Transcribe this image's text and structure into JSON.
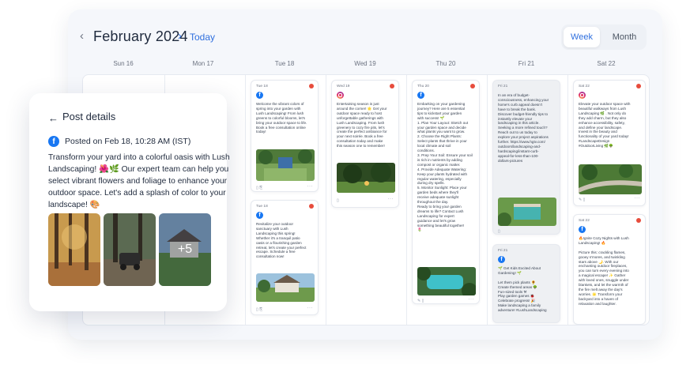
{
  "header": {
    "prev_icon": "‹",
    "month_title": "February 2024",
    "next_icon": "›",
    "today_label": "Today",
    "views": [
      "Week",
      "Month"
    ],
    "active_view": "Week"
  },
  "days": [
    "Sun 16",
    "Mon 17",
    "Tue 18",
    "Wed 19",
    "Thu 20",
    "Fri 21",
    "Sat 22"
  ],
  "cards": [
    {
      "date": "Tue 18",
      "network": "facebook-icon",
      "text": "Welcome the vibrant colors of\nspring into your garden with\nLush Landscaping! From lush\ngreens to colorful blooms, let's\nbring your outdoor space to life.\nBook a free consultation online\ntoday!"
    },
    {
      "date": "Tue 18",
      "network": "facebook-icon",
      "text": "Revitalize your outdoor\nsanctuary with Lush\nLandscaping this spring!\nWhether it's a tranquil patio\noasis or a flourishing garden\nretreat, let's create your perfect\nescape. Schedule a free\nconsultation now!"
    },
    {
      "date": "Wed 19",
      "network": "instagram-icon",
      "text": "Entertaining season is just\naround the corner! 🌟 Get your\noutdoor space ready to host\nunforgettable gatherings with\nLush Landscaping. From lush\ngreenery to cozy fire pits, let's\ncreate the perfect ambiance for\nyour next soirée. Book a free\nconsultation today and make\nthis season one to remember!"
    },
    {
      "date": "Thu 20",
      "network": "facebook-icon",
      "text": "Embarking on your gardening\njourney? Here are 5 essential\ntips to kickstart your garden\nwith success! 🌱\n1. Plan Your Layout: Sketch out\nyour garden space and decide\nwhat plants you want to grow.\n2. Choose the Right Plants:\nSelect plants that thrive in your\nlocal climate and soil\nconditions.\n3. Prep Your Soil: Ensure your soil\nis rich in nutrients by adding\ncompost or organic matter.\n4. Provide Adequate Watering:\nKeep your plants hydrated with\nregular watering, especially\nduring dry spells.\n5. Monitor Sunlight: Place your\ngarden beds where they'll\nreceive adequate sunlight\nthroughout the day.\nReady to bring your garden\ndreams to life? Contact Lush\nLandscaping for expert\nguidance and let's grow\nsomething beautiful together!\n🌷"
    },
    {
      "date": "Fri 21",
      "network": "",
      "text": "In an era of budget-\nconsciousness, enhancing your\nhome's curb appeal doesn't\nhave to break the bank.\nDiscover budget-friendly tips to\ninstantly elevate your\nlandscaping in this article.\nSeeking a more refined touch?\nReach out to us today to\nexplore your project aspirations\nfurther. https://www.hgtv.com/\noutdoors/landscaping-and-\nhardscaping/instant-curb-\nappeal-for-less-than-100-\ndollars-pictures"
    },
    {
      "date": "Fri 21",
      "network": "facebook-icon",
      "text": "🌱 Get Kids Excited About\nGardening! 🌱\n\nLet them pick plants 🌻\nCreate themed areas 🌳\nFun-sized tools ⚒\nPlay garden games 🐞\nCelebrate progress! 🎉\nMake landscaping a family\nadventure! #LushLandscaping"
    },
    {
      "date": "Sat 22",
      "network": "instagram-icon",
      "text": "Elevate your outdoor space with\nbeautiful walkways from Lush\nLandscaping 🌿 . Not only do\nthey add charm, but they also\nenhance accessibility, safety,\nand define your landscape.\nInvest in the beauty and\nfunctionality of your yard today!\n#LandscapeDesign\n#OutdoorLiving 🌿🌳"
    },
    {
      "date": "Sat 22",
      "network": "facebook-icon",
      "text": "🔥Ignite Cozy Nights with Lush\nLandscaping! 🔥\n\nPicture this: crackling flames,\ngooey s'mores, and twinkling\nstars above 🌙. With our\nenchanting outdoor fireplaces,\nyou can turn every evening into\na magical escape! ✨ Gather\nwith loved ones, snuggle under\nblankets, and let the warmth of\nthe fire melt away the day's\nworries. 🌟 Transform your\nbackyard into a haven of\nrelaxation and laughter."
    }
  ],
  "post_details": {
    "back_icon": "←",
    "title": "Post details",
    "network": "facebook-icon",
    "posted_on": "Posted on Feb 18, 10:28 AM (IST)",
    "body": "Transform your yard into a colorful oasis with Lush Landscaping! 🌺🌿 Our expert team can help you select vibrant flowers and foliage to enhance your outdoor space. Let's add a splash of color to your landscape! 🎨",
    "extra_images_label": "+5"
  },
  "colors": {
    "accent": "#2f6fde",
    "facebook": "#1877f2",
    "notification_dot": "#e74c3c",
    "background": "#f5f7fb"
  }
}
